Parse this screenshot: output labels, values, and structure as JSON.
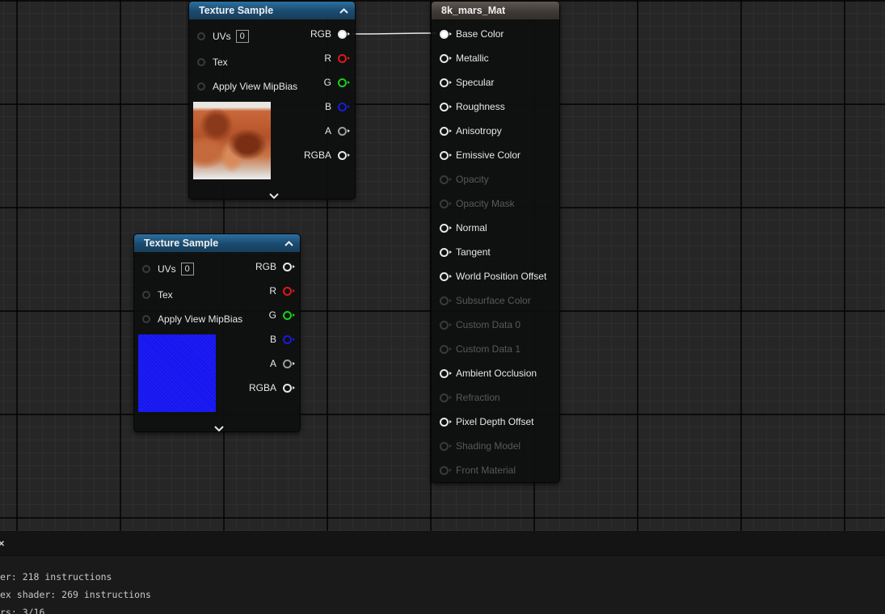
{
  "texture_node_1": {
    "title": "Texture Sample",
    "inputs": [
      {
        "label": "UVs",
        "value": "0"
      },
      {
        "label": "Tex"
      },
      {
        "label": "Apply View MipBias"
      }
    ],
    "outputs": [
      "RGB",
      "R",
      "G",
      "B",
      "A",
      "RGBA"
    ],
    "preview": "mars color texture"
  },
  "texture_node_2": {
    "title": "Texture Sample",
    "inputs": [
      {
        "label": "UVs",
        "value": "0"
      },
      {
        "label": "Tex"
      },
      {
        "label": "Apply View MipBias"
      }
    ],
    "outputs": [
      "RGB",
      "R",
      "G",
      "B",
      "A",
      "RGBA"
    ],
    "preview": "blue normal texture"
  },
  "material_node": {
    "title": "8k_mars_Mat",
    "inputs": [
      {
        "label": "Base Color",
        "enabled": true
      },
      {
        "label": "Metallic",
        "enabled": true
      },
      {
        "label": "Specular",
        "enabled": true
      },
      {
        "label": "Roughness",
        "enabled": true
      },
      {
        "label": "Anisotropy",
        "enabled": true
      },
      {
        "label": "Emissive Color",
        "enabled": true
      },
      {
        "label": "Opacity",
        "enabled": false
      },
      {
        "label": "Opacity Mask",
        "enabled": false
      },
      {
        "label": "Normal",
        "enabled": true
      },
      {
        "label": "Tangent",
        "enabled": true
      },
      {
        "label": "World Position Offset",
        "enabled": true
      },
      {
        "label": "Subsurface Color",
        "enabled": false
      },
      {
        "label": "Custom Data 0",
        "enabled": false
      },
      {
        "label": "Custom Data 1",
        "enabled": false
      },
      {
        "label": "Ambient Occlusion",
        "enabled": true
      },
      {
        "label": "Refraction",
        "enabled": false
      },
      {
        "label": "Pixel Depth Offset",
        "enabled": true
      },
      {
        "label": "Shading Model",
        "enabled": false
      },
      {
        "label": "Front Material",
        "enabled": false
      }
    ]
  },
  "connection": {
    "from": "texture_node_1.RGB",
    "to": "material_node.Base Color"
  },
  "stats_panel": {
    "close_icon": "×",
    "lines": [
      "er: 218 instructions",
      "ex shader: 269 instructions",
      "rs: 3/16"
    ]
  },
  "colors": {
    "texture_header": "#1f5580",
    "material_header": "#4a443e",
    "pin_red": "#e01818",
    "pin_green": "#18d018",
    "pin_blue": "#1a1ae0"
  }
}
